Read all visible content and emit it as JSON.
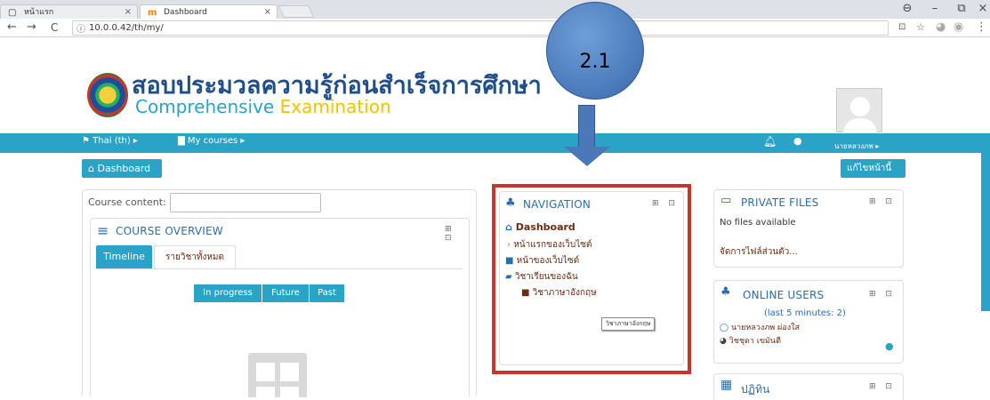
{
  "browser": {
    "tabs": [
      {
        "label": "หน้าแรก",
        "close": "×",
        "icon": "page-icon"
      },
      {
        "label": "Dashboard",
        "close": "×",
        "icon": "moodle-icon"
      }
    ],
    "window_controls": {
      "profile": "⊖",
      "minimize": "–",
      "restore": "⧉",
      "close": "×"
    },
    "back": "←",
    "forward": "→",
    "reload": "C",
    "url": "10.0.0.42/th/my/",
    "info": "ⓘ"
  },
  "header": {
    "logo_thai": "สอบประมวลความรู้ก่อนสำเร็จการศึกษา",
    "logo_en_1": "Comprehensive",
    "logo_en_2": "Examination"
  },
  "callout": {
    "text": "2.1"
  },
  "navbar": {
    "lang": "Thai (th) ▸",
    "courses": "My courses ▸",
    "user_name": "นายหลวงภพ ▸"
  },
  "page": {
    "dashboard_btn": "Dashboard",
    "edit_btn": "แก้ไขหน้านี้"
  },
  "course_content": {
    "label": "Course content:",
    "value": ""
  },
  "course_overview": {
    "title": "COURSE OVERVIEW",
    "tabs": [
      "Timeline",
      "รายวิชาทั้งหมด"
    ],
    "filters": [
      "In progress",
      "Future",
      "Past"
    ],
    "controls": "⊞ ⊡"
  },
  "navigation": {
    "title": "NAVIGATION",
    "controls": "⊞ ⊡",
    "items": [
      "Dashboard",
      "หน้าแรกของเว็บไซต์",
      "หน้าของเว็บไซต์",
      "วิชาเรียนของฉัน",
      "วิชาภาษาอังกฤษ"
    ],
    "tooltip": "วิชาภาษาอังกฤษ"
  },
  "private_files": {
    "title": "PRIVATE FILES",
    "controls": "⊞ ⊡",
    "empty": "No files available",
    "manage": "จัดการไฟล์ส่วนตัว..."
  },
  "online_users": {
    "title": "ONLINE USERS",
    "controls": "⊞ ⊡",
    "subtitle": "(last 5 minutes: 2)",
    "users": [
      "นายหลวงภพ ผ่องใส",
      "วิชชุดา เขมันตี"
    ]
  },
  "calendar": {
    "title": "ปฏิทิน",
    "controls": "⊞ ⊡"
  },
  "colors": {
    "brand": "#2aa3c6",
    "callout": "#4a78b8",
    "highlight": "#c0392b",
    "link": "#6c2b12"
  }
}
